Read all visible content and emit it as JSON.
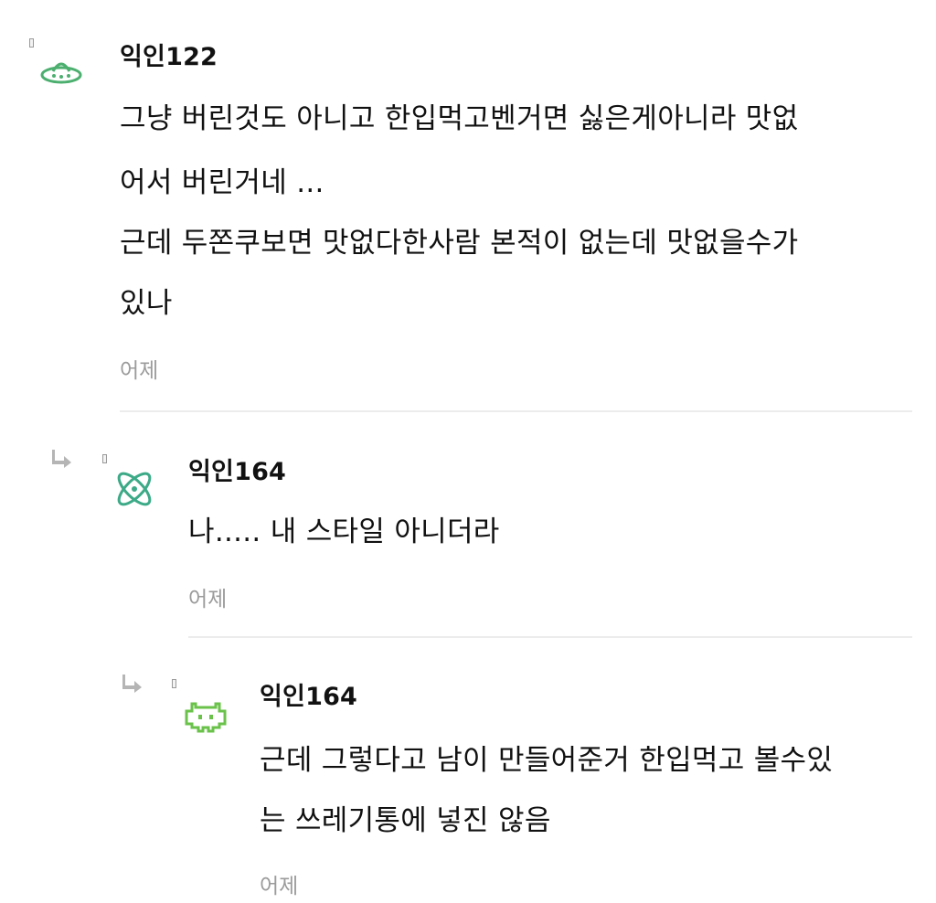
{
  "comments": [
    {
      "author": "익인122",
      "avatar_icon": "ufo-icon",
      "lines": [
        "그냥 버린것도 아니고 한입먹고벤거면 싫은게아니라 맛없",
        "어서 버린거네 ...",
        "근데 두쫀쿠보면 맛없다한사람 본적이 없는데 맛없을수가",
        "있나"
      ],
      "time": "어제"
    },
    {
      "author": "익인164",
      "avatar_icon": "atom-icon",
      "lines": [
        "나..... 내 스타일 아니더라"
      ],
      "time": "어제"
    },
    {
      "author": "익인164",
      "avatar_icon": "space-invader-icon",
      "lines": [
        "근데 그렇다고 남이 만들어준거 한입먹고 볼수있",
        "는 쓰레기통에 넣진 않음"
      ],
      "time": "어제"
    }
  ],
  "colors": {
    "avatar_green": "#4caf6f",
    "avatar_teal": "#3daa87",
    "avatar_lime": "#6ac24a",
    "meta_gray": "#9b9b9b",
    "divider": "#ececec"
  }
}
